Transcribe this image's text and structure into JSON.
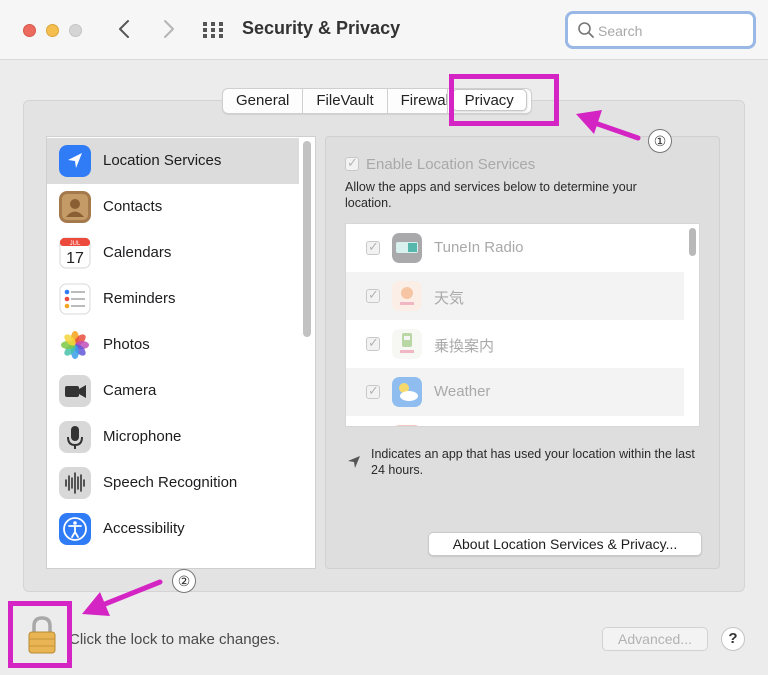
{
  "window": {
    "title": "Security & Privacy",
    "search_placeholder": "Search",
    "icons": {
      "back": "chevron-left-icon",
      "forward": "chevron-right-icon",
      "show_all": "grid-icon",
      "search": "search-icon"
    }
  },
  "tabs": [
    {
      "label": "General",
      "active": false
    },
    {
      "label": "FileVault",
      "active": false
    },
    {
      "label": "Firewall",
      "active": false
    },
    {
      "label": "Privacy",
      "active": true
    }
  ],
  "sidebar": {
    "items": [
      {
        "label": "Location Services",
        "icon": "location-arrow-icon",
        "selected": true
      },
      {
        "label": "Contacts",
        "icon": "contacts-icon",
        "selected": false
      },
      {
        "label": "Calendars",
        "icon": "calendar-icon",
        "selected": false
      },
      {
        "label": "Reminders",
        "icon": "reminders-icon",
        "selected": false
      },
      {
        "label": "Photos",
        "icon": "photos-icon",
        "selected": false
      },
      {
        "label": "Camera",
        "icon": "camera-icon",
        "selected": false
      },
      {
        "label": "Microphone",
        "icon": "microphone-icon",
        "selected": false
      },
      {
        "label": "Speech Recognition",
        "icon": "waveform-icon",
        "selected": false
      },
      {
        "label": "Accessibility",
        "icon": "accessibility-icon",
        "selected": false
      }
    ],
    "calendar_month": "JUL",
    "calendar_day": "17"
  },
  "location": {
    "enable_label": "Enable Location Services",
    "enable_checked": true,
    "description": "Allow the apps and services below to determine your location.",
    "apps": [
      {
        "name": "TuneIn Radio",
        "checked": true,
        "icon": "tunein-icon"
      },
      {
        "name": "天気",
        "checked": true,
        "icon": "yahoo-weather-icon"
      },
      {
        "name": "乗換案内",
        "checked": true,
        "icon": "yahoo-transit-icon"
      },
      {
        "name": "Weather",
        "checked": true,
        "icon": "weather-icon"
      }
    ],
    "note": "Indicates an app that has used your location within the last 24 hours.",
    "about_button": "About Location Services & Privacy..."
  },
  "footer": {
    "lock_text": "Click the lock to make changes.",
    "advanced_button": "Advanced...",
    "help_button": "?"
  },
  "annotations": {
    "badge1": "①",
    "badge2": "②",
    "highlight_color": "#d424c3"
  }
}
